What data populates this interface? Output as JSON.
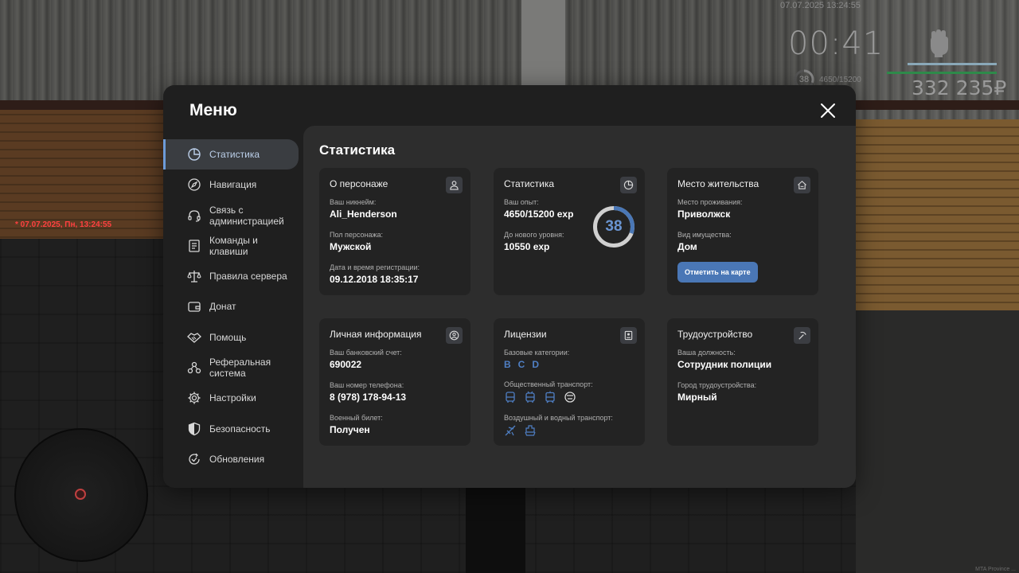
{
  "hud": {
    "datetime_top": "07.07.2025 13:24:55",
    "timer": "00:41",
    "level": "38",
    "exp": "4650/15200",
    "money": "332 235₽",
    "datetime_red": "* 07.07.2025, Пн, 13:24:55",
    "watermark": "MTA Province ..."
  },
  "menu": {
    "title": "Меню",
    "sidebar": [
      {
        "label": "Статистика",
        "icon": "pie-chart-icon",
        "active": true
      },
      {
        "label": "Навигация",
        "icon": "compass-icon"
      },
      {
        "label": "Связь с администрацией",
        "icon": "headset-icon"
      },
      {
        "label": "Команды и клавиши",
        "icon": "document-icon"
      },
      {
        "label": "Правила сервера",
        "icon": "scales-icon"
      },
      {
        "label": "Донат",
        "icon": "wallet-icon"
      },
      {
        "label": "Помощь",
        "icon": "handshake-icon"
      },
      {
        "label": "Реферальная система",
        "icon": "referral-icon"
      },
      {
        "label": "Настройки",
        "icon": "gear-icon"
      },
      {
        "label": "Безопасность",
        "icon": "shield-icon"
      },
      {
        "label": "Обновления",
        "icon": "refresh-check-icon"
      }
    ],
    "content_title": "Статистика",
    "cards": {
      "character": {
        "title": "О персонаже",
        "nickname_label": "Ваш никнейм:",
        "nickname": "Ali_Henderson",
        "gender_label": "Пол персонажа:",
        "gender": "Мужской",
        "reg_label": "Дата и время регистрации:",
        "reg": "09.12.2018 18:35:17"
      },
      "stats": {
        "title": "Статистика",
        "exp_label": "Ваш опыт:",
        "exp": "4650/15200 exp",
        "next_label": "До нового уровня:",
        "next": "10550 exp",
        "level": "38",
        "level_progress": 0.306
      },
      "residence": {
        "title": "Место жительства",
        "place_label": "Место проживания:",
        "place": "Приволжск",
        "property_label": "Вид имущества:",
        "property": "Дом",
        "map_button": "Отметить на карте"
      },
      "personal": {
        "title": "Личная информация",
        "bank_label": "Ваш банковский счет:",
        "bank": "690022",
        "phone_label": "Ваш номер телефона:",
        "phone": "8 (978) 178-94-13",
        "military_label": "Военный билет:",
        "military": "Получен"
      },
      "licenses": {
        "title": "Лицензии",
        "base_label": "Базовые категории:",
        "base_categories": [
          "B",
          "C",
          "D"
        ],
        "public_label": "Общественный транспорт:",
        "air_label": "Воздушный и водный транспорт:"
      },
      "employment": {
        "title": "Трудоустройство",
        "position_label": "Ваша должность:",
        "position": "Сотрудник полиции",
        "city_label": "Город трудоустройства:",
        "city": "Мирный"
      }
    }
  },
  "colors": {
    "accent": "#6d9bd8",
    "button": "#4a77b6",
    "license": "#4f7fc4"
  }
}
